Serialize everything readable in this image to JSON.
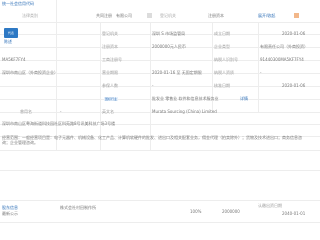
{
  "top": {
    "company_tag": "统一社会信用代码",
    "label_left": "法律类别",
    "value_left": "共同注册",
    "value_mid": "有限公司",
    "label_right": "登记机关",
    "row_label_right": "注册资本",
    "fold_label": "展开/收起"
  },
  "rows": {
    "r1": {
      "link": "陈述",
      "reg_no": "登记机关",
      "v1": "深圳 S 市场监管局",
      "label": "成立日期",
      "v2": "2020-01-06"
    },
    "r2": {
      "badge": "代表",
      "cap_label": "注册资本",
      "cap": "2000000元人民币",
      "type_label": "企业类型",
      "type": "有限责任公司（外商投资）"
    },
    "r3": {
      "code": "MA5KF7FY4",
      "ind_label": "工商注册号",
      "code_label": "纳税人识别号",
      "code_value": "91440300MA5KF7FY4"
    },
    "r4": {
      "addr": "深圳市南山区（外商投资企业）",
      "date_label": "营业期限",
      "date": "2020-01-16 至 无固定期限",
      "v": "纳税人资质",
      "v2": "-"
    },
    "r5": {
      "label": "参保人数",
      "value": "-",
      "label2": "核准日期",
      "value2": "2020-01-06"
    },
    "r6": {
      "tag": "国标行业",
      "value": "批发业 零售业 软件和信息技术服务业",
      "link": "详情"
    },
    "r7": {
      "label": "曾用名",
      "value": "-",
      "label2": "英文名",
      "value2": "Murata Sourcing (China) Limited"
    },
    "r8": {
      "addr": "深圳市南山区粤海街道科技园社区科苑路8号讯美科技广场3号楼"
    },
    "r9": {
      "text": "经营范围：一般经营项目是：电子元器件、机械设备、化工产品、计算机软硬件的批发、进出口及相关配套业务，佣金代理（拍卖除外）；货物及技术进出口；商务信息咨询；企业管理咨询。"
    }
  },
  "shareholders": {
    "title": "股东信息",
    "sub": "最新公示",
    "name": "株式会社村田制作所",
    "pct": "100%",
    "amount": "2000000",
    "date_label": "认缴出资日期",
    "date": "2040-01-01"
  }
}
